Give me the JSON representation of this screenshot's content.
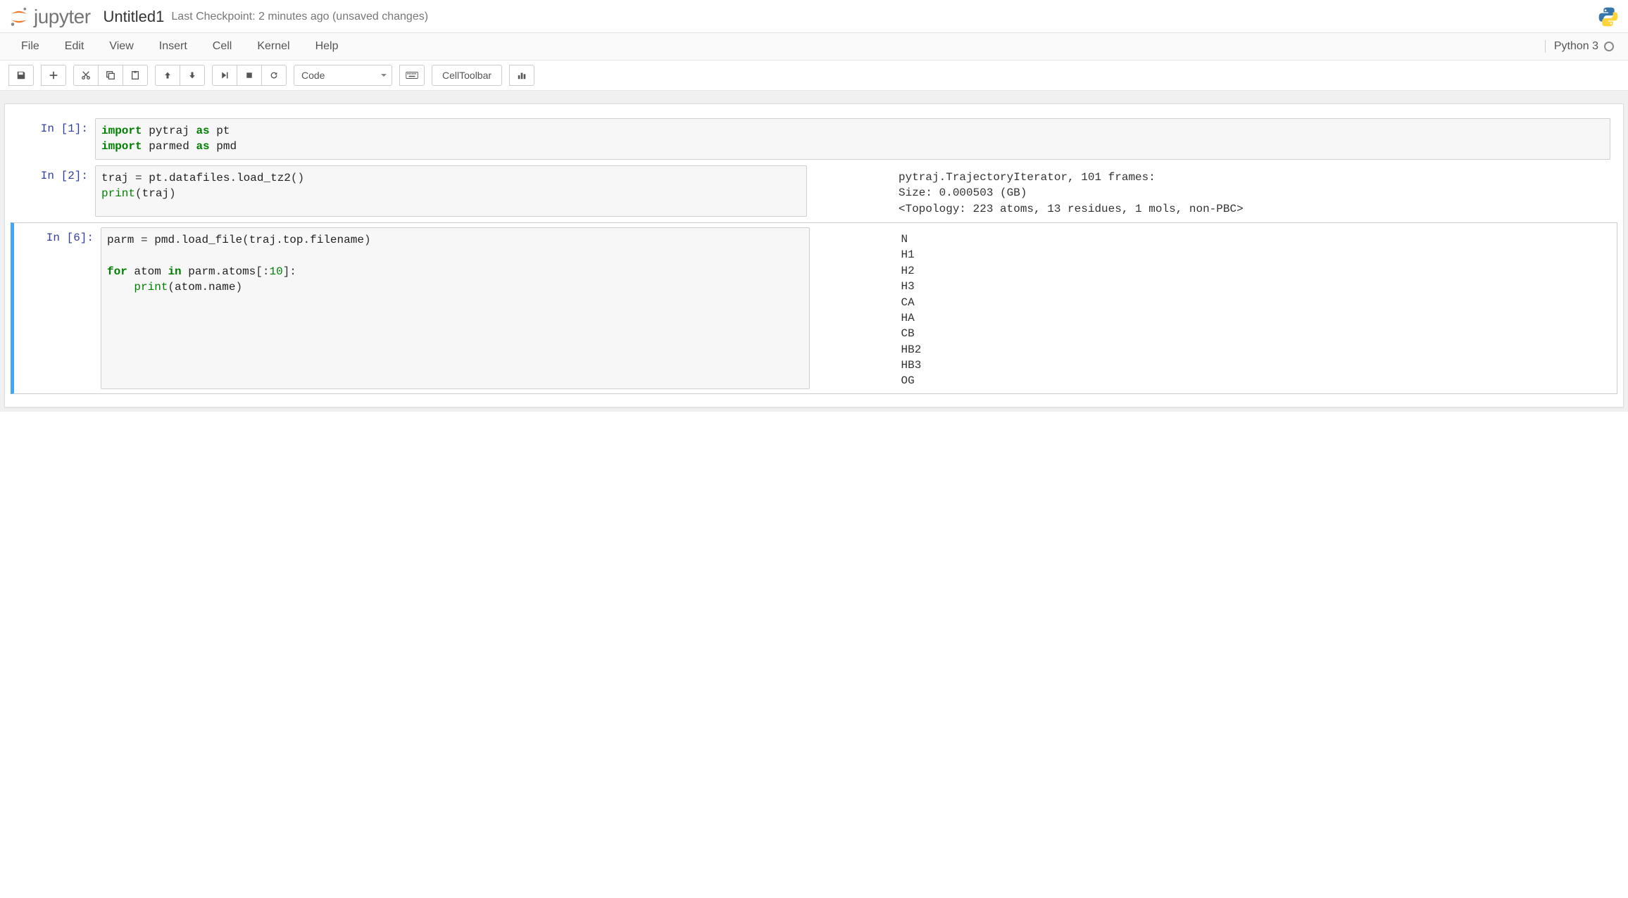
{
  "header": {
    "logo_text": "jupyter",
    "notebook_name": "Untitled1",
    "checkpoint": "Last Checkpoint: 2 minutes ago (unsaved changes)"
  },
  "menubar": {
    "items": [
      "File",
      "Edit",
      "View",
      "Insert",
      "Cell",
      "Kernel",
      "Help"
    ],
    "kernel_name": "Python 3"
  },
  "toolbar": {
    "cell_type": "Code",
    "cell_toolbar_label": "CellToolbar"
  },
  "cells": [
    {
      "prompt": "In [1]:",
      "code_html": "<span class='k-green'>import</span> <span class='ident'>pytraj</span> <span class='k-green'>as</span> <span class='ident'>pt</span>\n<span class='k-green'>import</span> <span class='ident'>parmed</span> <span class='k-green'>as</span> <span class='ident'>pmd</span>",
      "output": ""
    },
    {
      "prompt": "In [2]:",
      "code_html": "<span class='ident'>traj</span> <span class='paren'>=</span> <span class='ident'>pt</span><span class='paren'>.</span><span class='ident'>datafiles</span><span class='paren'>.</span><span class='ident'>load_tz2</span><span class='paren'>()</span>\n<span class='k-builtin'>print</span><span class='paren'>(</span><span class='ident'>traj</span><span class='paren'>)</span>",
      "output": "pytraj.TrajectoryIterator, 101 frames: \nSize: 0.000503 (GB)\n<Topology: 223 atoms, 13 residues, 1 mols, non-PBC>\n"
    },
    {
      "prompt": "In [6]:",
      "selected": true,
      "code_html": "<span class='ident'>parm</span> <span class='paren'>=</span> <span class='ident'>pmd</span><span class='paren'>.</span><span class='ident'>load_file</span><span class='paren'>(</span><span class='ident'>traj</span><span class='paren'>.</span><span class='ident'>top</span><span class='paren'>.</span><span class='ident'>filename</span><span class='paren'>)</span>\n\n<span class='k-green'>for</span> <span class='ident'>atom</span> <span class='k-green'>in</span> <span class='ident'>parm</span><span class='paren'>.</span><span class='ident'>atoms</span><span class='paren'>[:</span><span class='k-num'>10</span><span class='paren'>]:</span>\n    <span class='k-builtin'>print</span><span class='paren'>(</span><span class='ident'>atom</span><span class='paren'>.</span><span class='ident'>name</span><span class='paren'>)</span>",
      "output": "N\nH1\nH2\nH3\nCA\nHA\nCB\nHB2\nHB3\nOG"
    }
  ]
}
